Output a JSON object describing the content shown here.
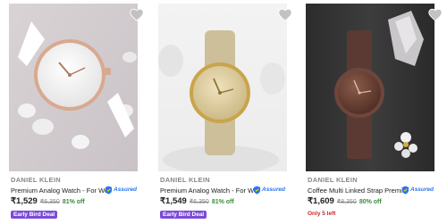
{
  "products": [
    {
      "brand": "DANIEL KLEIN",
      "title": "Premium Analog Watch - For Wo...",
      "assured_label": "Assured",
      "price": "₹1,529",
      "mrp": "₹6,350",
      "discount": "81% off",
      "tag": "Early Bird Deal",
      "wishlist_icon": "heart-icon"
    },
    {
      "brand": "DANIEL KLEIN",
      "title": "Premium Analog Watch - For Wo...",
      "assured_label": "Assured",
      "price": "₹1,549",
      "mrp": "₹6,350",
      "discount": "81% off",
      "tag": "Early Bird Deal",
      "wishlist_icon": "heart-icon"
    },
    {
      "brand": "DANIEL KLEIN",
      "title": "Coffee Multi Linked Strap Premi...",
      "assured_label": "Assured",
      "price": "₹1,609",
      "mrp": "₹8,350",
      "discount": "80% off",
      "tag": "Only 5 left",
      "wishlist_icon": "heart-icon"
    }
  ],
  "colors": {
    "deal_bg": "#7b4bd8",
    "discount": "#388e3c",
    "assured": "#2874f0",
    "low_stock": "#c62828"
  }
}
